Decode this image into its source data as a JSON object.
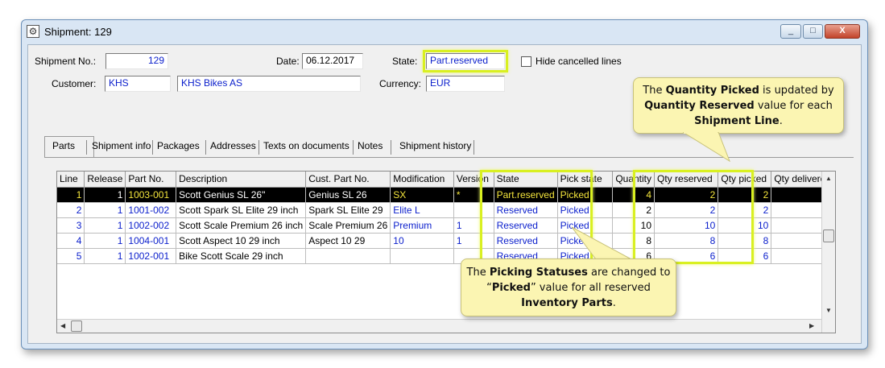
{
  "window": {
    "title": "Shipment: 129",
    "buttons": {
      "minimize": "_",
      "maximize": "□",
      "close": "X"
    }
  },
  "header": {
    "shipment_no_label": "Shipment No.:",
    "shipment_no": "129",
    "date_label": "Date:",
    "date": "06.12.2017",
    "state_label": "State:",
    "state": "Part.reserved",
    "hide_cancelled_label": "Hide cancelled lines",
    "customer_label": "Customer:",
    "customer_code": "KHS",
    "customer_name": "KHS Bikes AS",
    "currency_label": "Currency:",
    "currency": "EUR"
  },
  "tabs": [
    {
      "label": "Parts"
    },
    {
      "label": "Shipment info"
    },
    {
      "label": "Packages"
    },
    {
      "label": "Addresses"
    },
    {
      "label": "Texts on documents"
    },
    {
      "label": "Notes"
    },
    {
      "label": "Shipment history"
    }
  ],
  "grid": {
    "columns": [
      "Line",
      "Release",
      "Part No.",
      "Description",
      "Cust. Part No.",
      "Modification",
      "Version",
      "State",
      "Pick state",
      "Quantity",
      "Qty reserved",
      "Qty picked",
      "Qty delivered"
    ],
    "rows": [
      {
        "line": "1",
        "release": "1",
        "part_no": "1003-001",
        "description": "Scott Genius SL 26\"",
        "cust_part_no": "Genius SL 26",
        "modification": "SX",
        "version": "*",
        "state": "Part.reserved",
        "pick_state": "Picked",
        "quantity": "4",
        "qty_reserved": "2",
        "qty_picked": "2",
        "qty_delivered": ""
      },
      {
        "line": "2",
        "release": "1",
        "part_no": "1001-002",
        "description": "Scott Spark SL Elite 29 inch",
        "cust_part_no": "Spark SL Elite 29",
        "modification": "Elite L",
        "version": "",
        "state": "Reserved",
        "pick_state": "Picked",
        "quantity": "2",
        "qty_reserved": "2",
        "qty_picked": "2",
        "qty_delivered": ""
      },
      {
        "line": "3",
        "release": "1",
        "part_no": "1002-002",
        "description": "Scott Scale Premium 26 inch",
        "cust_part_no": "Scale Premium 26",
        "modification": "Premium",
        "version": "1",
        "state": "Reserved",
        "pick_state": "Picked",
        "quantity": "10",
        "qty_reserved": "10",
        "qty_picked": "10",
        "qty_delivered": ""
      },
      {
        "line": "4",
        "release": "1",
        "part_no": "1004-001",
        "description": "Scott Aspect 10 29 inch",
        "cust_part_no": "Aspect 10 29",
        "modification": "10",
        "version": "1",
        "state": "Reserved",
        "pick_state": "Picked",
        "quantity": "8",
        "qty_reserved": "8",
        "qty_picked": "8",
        "qty_delivered": ""
      },
      {
        "line": "5",
        "release": "1",
        "part_no": "1002-001",
        "description": "Bike Scott Scale 29 inch",
        "cust_part_no": "",
        "modification": "",
        "version": "",
        "state": "Reserved",
        "pick_state": "Picked",
        "quantity": "6",
        "qty_reserved": "6",
        "qty_picked": "6",
        "qty_delivered": ""
      }
    ]
  },
  "callouts": {
    "top": {
      "t1": "The ",
      "b1": "Quantity Picked",
      "t2": " is updated by ",
      "b2": "Quantity Reserved",
      "t3": " value for each ",
      "b3": "Shipment Line",
      "t4": "."
    },
    "bottom": {
      "t1": "The ",
      "b1": "Picking Statuses",
      "t2": " are changed to “",
      "b2": "Picked",
      "t3": "” value for all reserved ",
      "b3": "Inventory Parts",
      "t4": "."
    }
  },
  "colors": {
    "highlight": "#d9f021",
    "callout_bg": "#fbf5b2",
    "value_text": "#0a1ecc",
    "selected_text": "#f4e53c"
  }
}
